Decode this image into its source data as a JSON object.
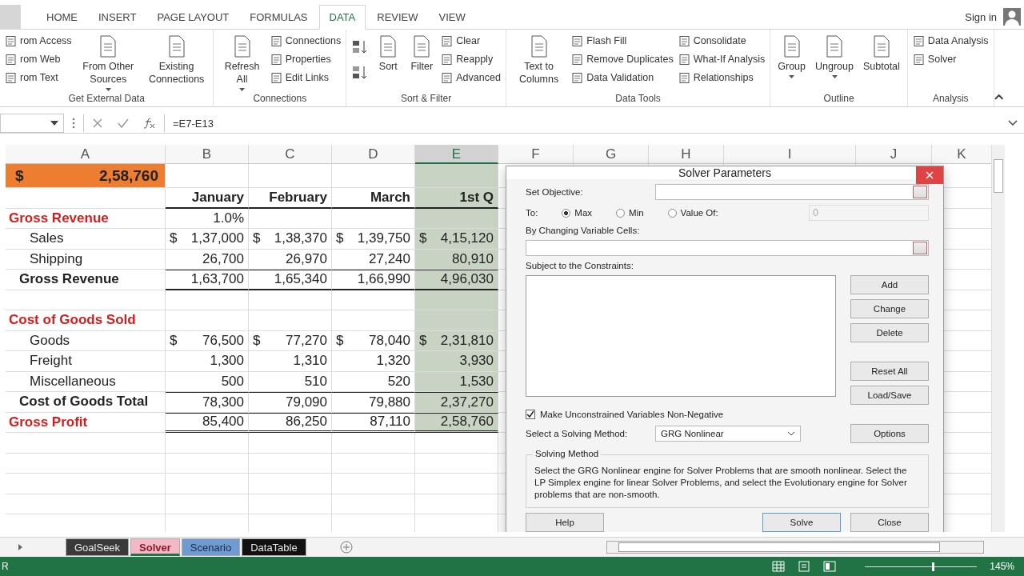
{
  "ribbon_tabs": [
    {
      "label": "HOME",
      "selected": false
    },
    {
      "label": "INSERT",
      "selected": false
    },
    {
      "label": "PAGE LAYOUT",
      "selected": false
    },
    {
      "label": "FORMULAS",
      "selected": false
    },
    {
      "label": "DATA",
      "selected": true
    },
    {
      "label": "REVIEW",
      "selected": false
    },
    {
      "label": "VIEW",
      "selected": false
    }
  ],
  "account": {
    "label": "Sign in"
  },
  "ribbon_groups": [
    {
      "title": "Get External Data",
      "controls": [
        {
          "kind": "stack",
          "items": [
            {
              "label": "rom Access"
            },
            {
              "label": "rom Web"
            },
            {
              "label": "rom Text"
            }
          ]
        },
        {
          "kind": "large",
          "label": "From Other Sources",
          "dropdown": true
        },
        {
          "kind": "large",
          "label": "Existing Connections",
          "dropdown": false
        }
      ]
    },
    {
      "title": "Connections",
      "controls": [
        {
          "kind": "large",
          "label": "Refresh All",
          "dropdown": true
        },
        {
          "kind": "stack",
          "items": [
            {
              "label": "Connections"
            },
            {
              "label": "Properties"
            },
            {
              "label": "Edit Links"
            }
          ]
        }
      ]
    },
    {
      "title": "Sort & Filter",
      "controls": [
        {
          "kind": "sort"
        },
        {
          "kind": "large",
          "label": "Sort",
          "dropdown": false
        },
        {
          "kind": "large",
          "label": "Filter",
          "dropdown": false
        },
        {
          "kind": "stack",
          "items": [
            {
              "label": "Clear"
            },
            {
              "label": "Reapply"
            },
            {
              "label": "Advanced"
            }
          ]
        }
      ]
    },
    {
      "title": "Data Tools",
      "controls": [
        {
          "kind": "large",
          "label": "Text to Columns",
          "dropdown": false
        },
        {
          "kind": "stack",
          "items": [
            {
              "label": "Flash Fill"
            },
            {
              "label": "Remove Duplicates"
            },
            {
              "label": "Data Validation"
            }
          ]
        },
        {
          "kind": "stack",
          "items": [
            {
              "label": "Consolidate"
            },
            {
              "label": "What-If Analysis"
            },
            {
              "label": "Relationships"
            }
          ]
        }
      ]
    },
    {
      "title": "Outline",
      "controls": [
        {
          "kind": "large",
          "label": "Group",
          "dropdown": true
        },
        {
          "kind": "large",
          "label": "Ungroup",
          "dropdown": true
        },
        {
          "kind": "large",
          "label": "Subtotal",
          "dropdown": false
        }
      ]
    },
    {
      "title": "Analysis",
      "controls": [
        {
          "kind": "stack",
          "items": [
            {
              "label": "Data Analysis"
            },
            {
              "label": "Solver"
            }
          ]
        }
      ]
    }
  ],
  "formula_bar": {
    "formula": "=E7-E13"
  },
  "columns": [
    {
      "label": "A",
      "selected": false
    },
    {
      "label": "B",
      "selected": false
    },
    {
      "label": "C",
      "selected": false
    },
    {
      "label": "D",
      "selected": false
    },
    {
      "label": "E",
      "selected": true
    },
    {
      "label": "F",
      "selected": false
    },
    {
      "label": "G",
      "selected": false
    },
    {
      "label": "H",
      "selected": false
    },
    {
      "label": "I",
      "selected": false
    },
    {
      "label": "J",
      "selected": false
    },
    {
      "label": "K",
      "selected": false
    }
  ],
  "rows": [
    {
      "kind": "highlight",
      "cells": [
        {
          "currency": "$",
          "value": "2,58,760"
        },
        {},
        {},
        {},
        {}
      ]
    },
    {
      "kind": "header",
      "cells": [
        {},
        {
          "value": "January"
        },
        {
          "value": "February"
        },
        {
          "value": "March"
        },
        {
          "value": "1st Q"
        }
      ]
    },
    {
      "kind": "section",
      "cells": [
        {
          "value": "Gross Revenue"
        },
        {
          "value": "1.0%"
        },
        {},
        {},
        {}
      ]
    },
    {
      "kind": "item",
      "cells": [
        {
          "value": "Sales"
        },
        {
          "currency": "$",
          "value": "1,37,000"
        },
        {
          "currency": "$",
          "value": "1,38,370"
        },
        {
          "currency": "$",
          "value": "1,39,750"
        },
        {
          "currency": "$",
          "value": "4,15,120"
        }
      ]
    },
    {
      "kind": "item",
      "cells": [
        {
          "value": "Shipping"
        },
        {
          "value": "26,700"
        },
        {
          "value": "26,970"
        },
        {
          "value": "27,240"
        },
        {
          "value": "80,910"
        }
      ]
    },
    {
      "kind": "total",
      "cells": [
        {
          "value": "Gross Revenue"
        },
        {
          "value": "1,63,700"
        },
        {
          "value": "1,65,340"
        },
        {
          "value": "1,66,990"
        },
        {
          "value": "4,96,030"
        }
      ]
    },
    {
      "kind": "blank",
      "cells": [
        {},
        {},
        {},
        {},
        {}
      ]
    },
    {
      "kind": "section",
      "cells": [
        {
          "value": "Cost of Goods Sold"
        },
        {},
        {},
        {},
        {}
      ]
    },
    {
      "kind": "item",
      "cells": [
        {
          "value": "Goods"
        },
        {
          "currency": "$",
          "value": "76,500"
        },
        {
          "currency": "$",
          "value": "77,270"
        },
        {
          "currency": "$",
          "value": "78,040"
        },
        {
          "currency": "$",
          "value": "2,31,810"
        }
      ]
    },
    {
      "kind": "item",
      "cells": [
        {
          "value": "Freight"
        },
        {
          "value": "1,300"
        },
        {
          "value": "1,310"
        },
        {
          "value": "1,320"
        },
        {
          "value": "3,930"
        }
      ]
    },
    {
      "kind": "item",
      "cells": [
        {
          "value": "Miscellaneous"
        },
        {
          "value": "500"
        },
        {
          "value": "510"
        },
        {
          "value": "520"
        },
        {
          "value": "1,530"
        }
      ]
    },
    {
      "kind": "subtotal",
      "cells": [
        {
          "value": "Cost of Goods Total"
        },
        {
          "value": "78,300"
        },
        {
          "value": "79,090"
        },
        {
          "value": "79,880"
        },
        {
          "value": "2,37,270"
        }
      ]
    },
    {
      "kind": "profit",
      "cells": [
        {
          "value": "Gross Profit"
        },
        {
          "value": "85,400"
        },
        {
          "value": "86,250"
        },
        {
          "value": "87,110"
        },
        {
          "value": "2,58,760"
        }
      ]
    }
  ],
  "solver_dialog": {
    "title": "Solver Parameters",
    "objective_label": "Set Objective:",
    "to_label": "To:",
    "targets": [
      {
        "label": "Max",
        "selected": true
      },
      {
        "label": "Min",
        "selected": false
      },
      {
        "label": "Value Of:",
        "selected": false
      }
    ],
    "value_of": {
      "value": "0",
      "disabled": true
    },
    "changing_label": "By Changing Variable Cells:",
    "constraints_label": "Subject to the Constraints:",
    "constraint_buttons": [
      "Add",
      "Change",
      "Delete",
      "Reset All",
      "Load/Save"
    ],
    "nonnegative": {
      "label": "Make Unconstrained Variables Non-Negative",
      "checked": true
    },
    "method_label": "Select a Solving Method:",
    "method_value": "GRG Nonlinear",
    "options_button": "Options",
    "method_group": {
      "title": "Solving Method",
      "text": "Select the GRG Nonlinear engine for Solver Problems that are smooth nonlinear. Select the LP Simplex engine for linear Solver Problems, and select the Evolutionary engine for Solver problems that are non-smooth."
    },
    "buttons": [
      "Help",
      "Solve",
      "Close"
    ]
  },
  "sheet_tabs": [
    {
      "label": "GoalSeek",
      "color": "#3a3a3a",
      "selected": false
    },
    {
      "label": "Solver",
      "color": "#f2b8c6",
      "selected": true
    },
    {
      "label": "Scenario",
      "color": "#6f9bd1",
      "selected": false
    },
    {
      "label": "DataTable",
      "color": "#111111",
      "selected": false
    }
  ],
  "status_bar": {
    "mode": "R",
    "zoom": "145%",
    "level": 0.6
  }
}
